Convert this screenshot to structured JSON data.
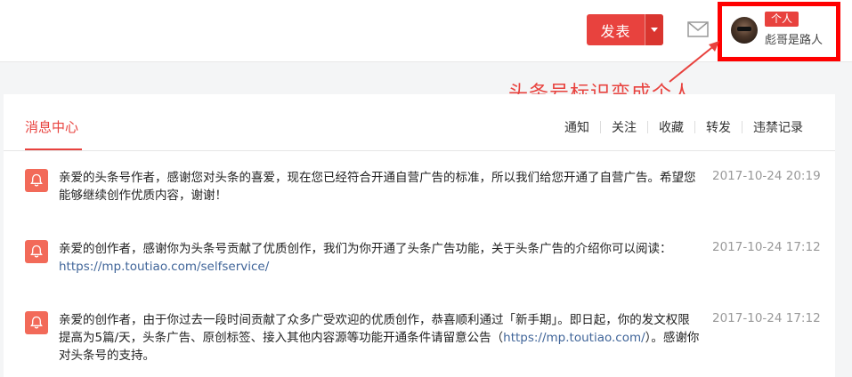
{
  "header": {
    "publish_label": "发表",
    "user_badge": "个人",
    "username": "彪哥是路人"
  },
  "annotation": {
    "text": "头条号标识变成个人",
    "color": "#e8423e"
  },
  "panel": {
    "title": "消息中心",
    "tabs": [
      "通知",
      "关注",
      "收藏",
      "转发",
      "违禁记录"
    ]
  },
  "messages": [
    {
      "text": "亲爱的头条号作者，感谢您对头条的喜爱，现在您已经符合开通自营广告的标准，所以我们给您开通了自营广告。希望您能够继续创作优质内容，谢谢！",
      "link": "",
      "text_after": "",
      "time": "2017-10-24 20:19"
    },
    {
      "text": "亲爱的创作者，感谢你为头条号贡献了优质创作，我们为你开通了头条广告功能，关于头条广告的介绍你可以阅读：",
      "link": "https://mp.toutiao.com/selfservice/",
      "text_after": "",
      "time": "2017-10-24 17:12"
    },
    {
      "text": "亲爱的创作者，由于你过去一段时间贡献了众多广受欢迎的优质创作，恭喜顺利通过「新手期」。即日起，你的发文权限提高为5篇/天，头条广告、原创标签、接入其他内容源等功能开通条件请留意公告（",
      "link": "https://mp.toutiao.com/",
      "text_after": "）。感谢你对头条号的支持。",
      "time": "2017-10-24 17:12"
    }
  ],
  "colors": {
    "accent": "#e8423e",
    "highlight_box": "#ff0000",
    "link": "#406599"
  }
}
